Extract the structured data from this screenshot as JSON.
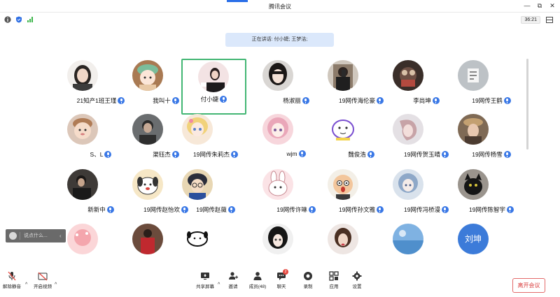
{
  "window": {
    "title": "腾讯会议",
    "controls": {
      "minimize": "—",
      "restore": "⧉",
      "close": "✕"
    }
  },
  "status": {
    "time": "36:21"
  },
  "speaking": {
    "text": "正在讲话: 付小婕; 王梦洁;"
  },
  "participants": [
    {
      "name": "21知产1班王瑾",
      "avatar": "portrait-girl-dark-hair",
      "active": false
    },
    {
      "name": "我叫十",
      "avatar": "cartoon-green-hat",
      "active": false
    },
    {
      "name": "付小婕",
      "avatar": "portrait-girl-pink",
      "active": true
    },
    {
      "name": "杨淑丽",
      "avatar": "portrait-girl-bangs",
      "active": false
    },
    {
      "name": "19网传海伦豪",
      "avatar": "portrait-boy-mirror",
      "active": false
    },
    {
      "name": "李尚坤",
      "avatar": "photo-dark-toy",
      "active": false
    },
    {
      "name": "19网传王鹤",
      "avatar": "photo-gray-sign",
      "active": false
    },
    {
      "name": "S、L",
      "avatar": "portrait-baby",
      "active": false
    },
    {
      "name": "渠钰杰",
      "avatar": "portrait-man-gray",
      "active": false
    },
    {
      "name": "19网传朱莉杰",
      "avatar": "anime-blonde-girl",
      "active": false
    },
    {
      "name": "wjm",
      "avatar": "anime-pink-girl",
      "active": false
    },
    {
      "name": "魏俊浩",
      "avatar": "doodle-face",
      "active": false
    },
    {
      "name": "19网传贺玉晴",
      "avatar": "illustration-side-face",
      "active": false
    },
    {
      "name": "19网传杨雪",
      "avatar": "photo-girl-hat",
      "active": false
    },
    {
      "name": "新新中",
      "avatar": "portrait-man-dark",
      "active": false
    },
    {
      "name": "19网传赵怡欢",
      "avatar": "cartoon-dog",
      "active": false
    },
    {
      "name": "19网传赵薇",
      "avatar": "anime-boy-glasses",
      "active": false
    },
    {
      "name": "19网传许琳",
      "avatar": "cartoon-bunny",
      "active": false
    },
    {
      "name": "19网传孙文雅",
      "avatar": "cartoon-surprised",
      "active": false
    },
    {
      "name": "19网传冯桥漫",
      "avatar": "anime-blue-girl",
      "active": false
    },
    {
      "name": "19网传陈智宇",
      "avatar": "photo-black-cat",
      "active": false
    },
    {
      "name": "",
      "avatar": "pink-cartoon",
      "active": false
    },
    {
      "name": "",
      "avatar": "football-player-red",
      "active": false
    },
    {
      "name": "",
      "avatar": "doodle-dog",
      "active": false
    },
    {
      "name": "",
      "avatar": "anime-dark-hair",
      "active": false
    },
    {
      "name": "",
      "avatar": "portrait-girl-brown",
      "active": false
    },
    {
      "name": "",
      "avatar": "photo-blue-sky",
      "active": false
    },
    {
      "name": "",
      "avatar": "blue-text-avatar",
      "text": "刘坤",
      "active": false
    }
  ],
  "chat": {
    "placeholder": "说点什么..."
  },
  "toolbar": {
    "unmute": "解除静音",
    "start_video": "开启视频",
    "share_screen": "共享屏幕",
    "invite": "邀请",
    "members": "成员(48)",
    "chat": "聊天",
    "chat_badge": "2",
    "record": "录制",
    "apps": "应用",
    "settings": "设置",
    "leave": "离开会议"
  },
  "colors": {
    "accent": "#3a78e6",
    "active_border": "#43b674",
    "leave": "#d83b3b",
    "banner": "#dbe8fb"
  }
}
